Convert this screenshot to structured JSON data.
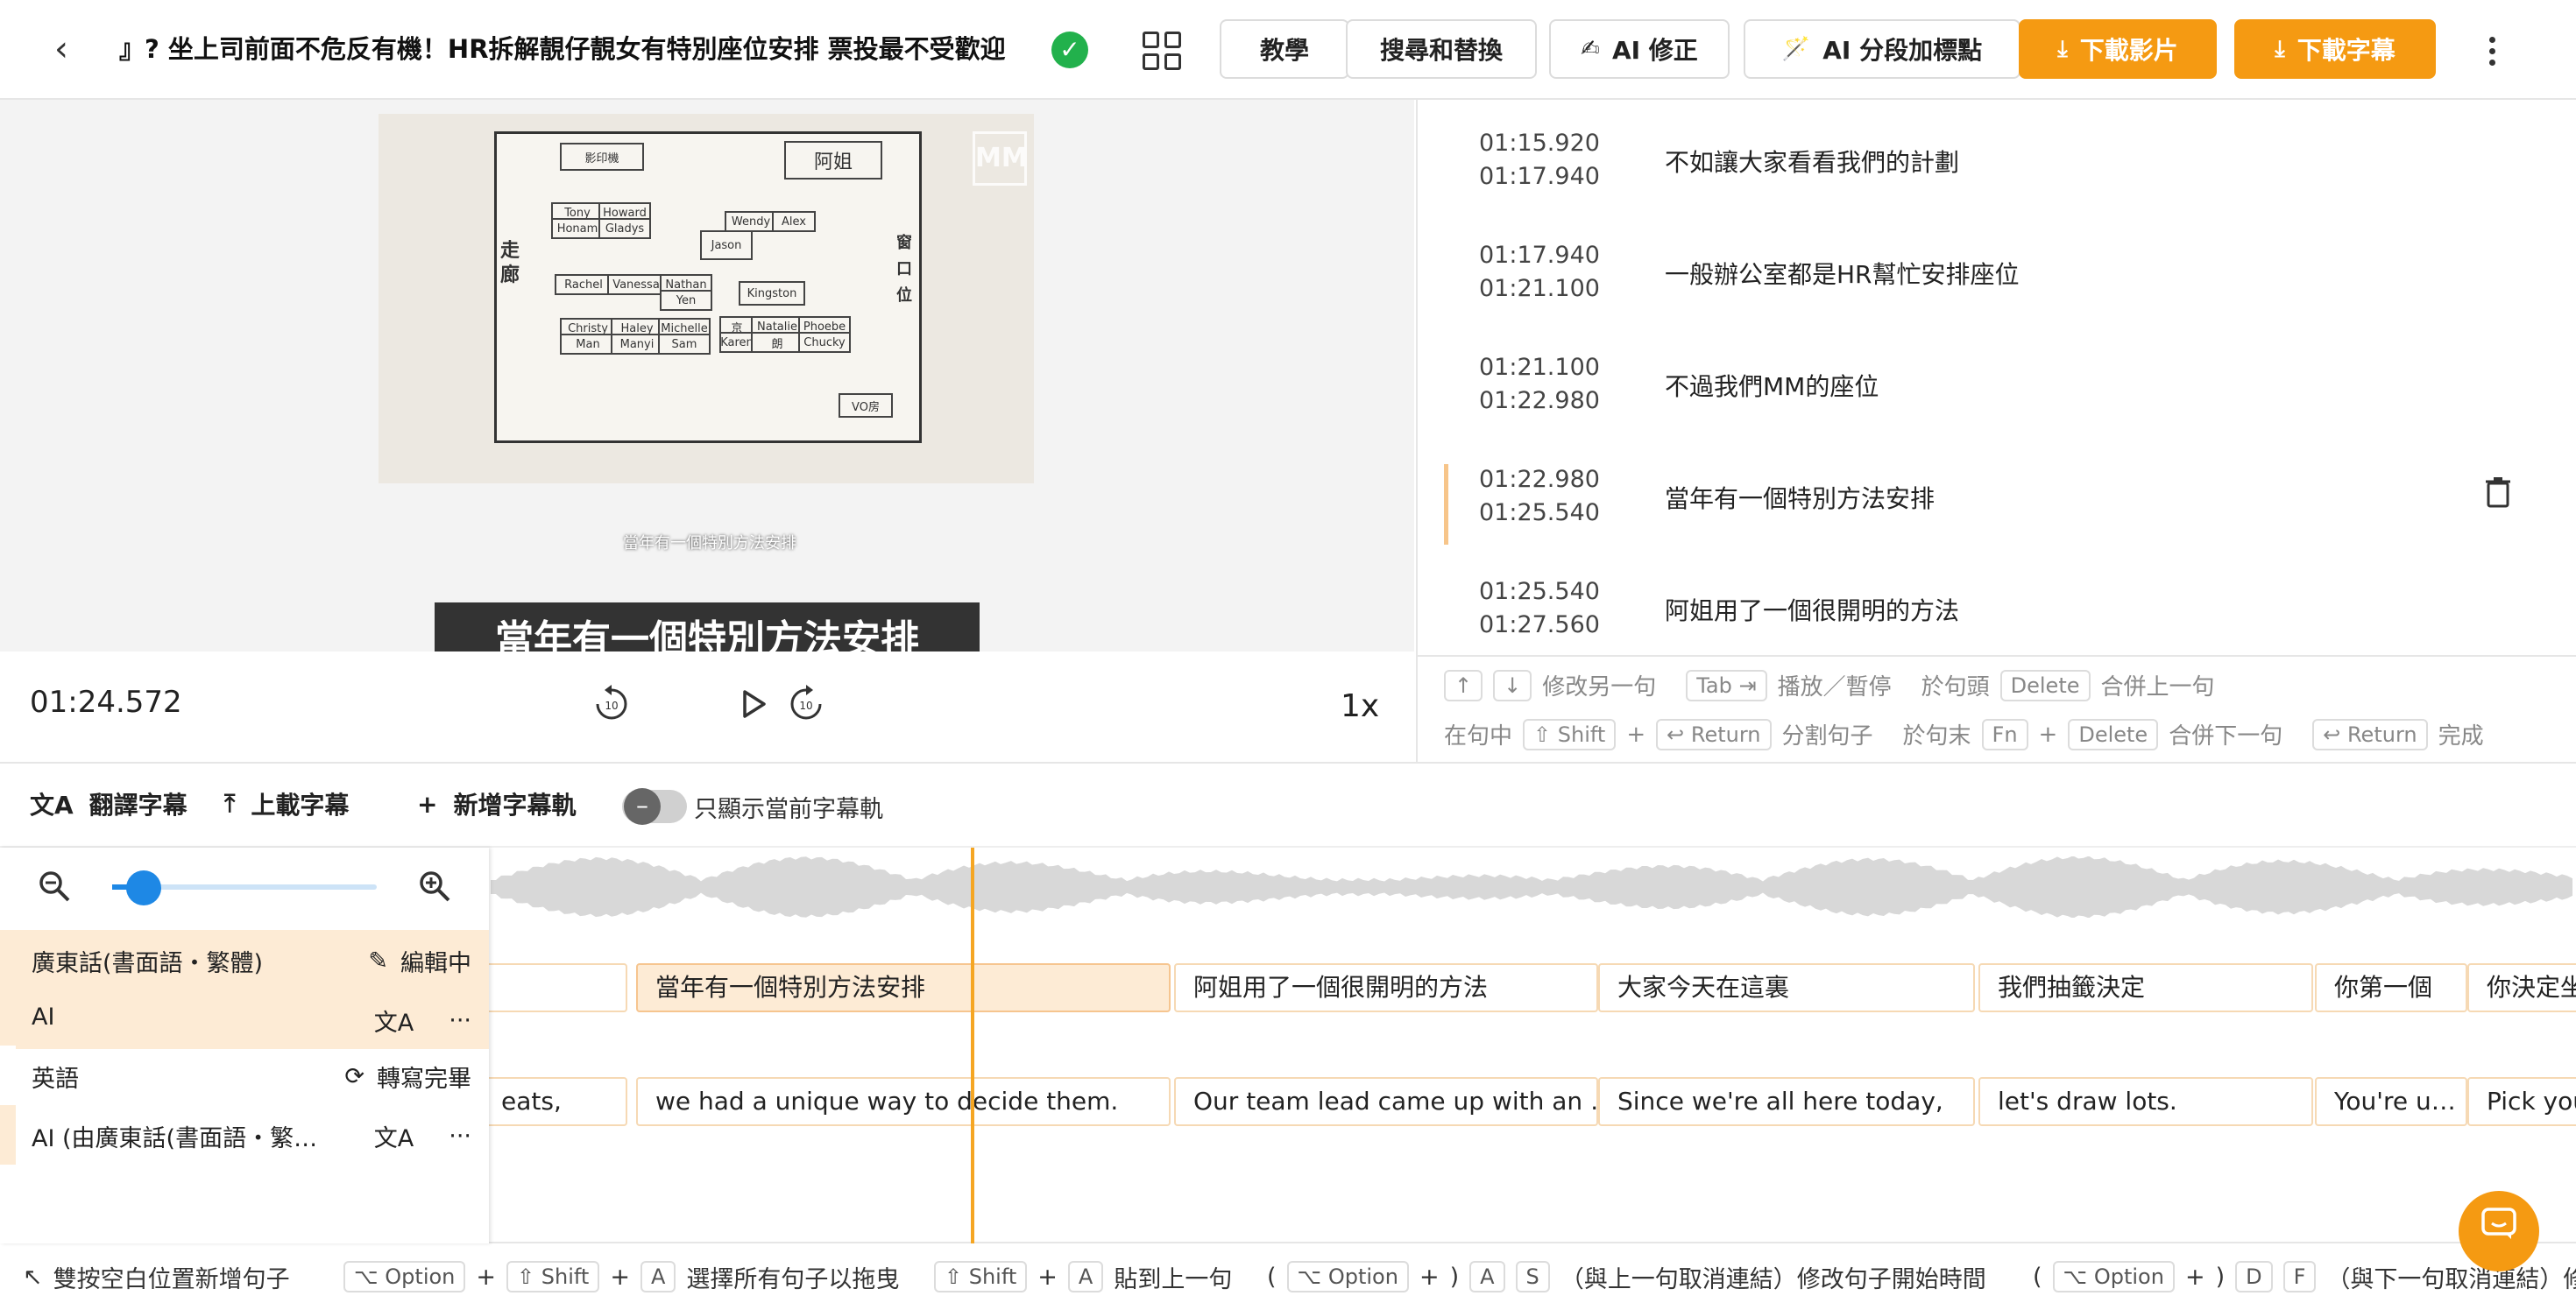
{
  "header": {
    "title": "』? 坐上司前面不危反有機！HR拆解靚仔靚女有特別座位安排 票投最不受歡迎",
    "buttons": {
      "tutorial": "教學",
      "find_replace": "搜尋和替換",
      "ai_correct": "AI 修正",
      "ai_segment": "AI 分段加標點",
      "download_video": "下載影片",
      "download_subtitles": "下載字幕"
    },
    "icons": {
      "ai_correct": "✍",
      "ai_segment": "🪄",
      "download": "⤓"
    }
  },
  "video": {
    "current_subtitle": "當年有一個特別方法安排",
    "burned_subtitle": "當年有一個特別方法安排",
    "watermark": "MM",
    "current_time": "01:24.572",
    "speed": "1x",
    "progress": 0.06,
    "drawing": {
      "printer": "影印機",
      "boss": "阿姐",
      "corridor": "走廊",
      "window": "窗口位",
      "names": [
        "Tony",
        "Howard",
        "Honam",
        "Gladys",
        "Wendy",
        "Alex",
        "Jason",
        "Rachel",
        "Vanessa",
        "Nathan",
        "Yen",
        "Kingston",
        "Christy",
        "Haley",
        "Michelle",
        "Man",
        "Manyi",
        "Sam",
        "京",
        "Natalie",
        "Phoebe",
        "Karen",
        "朗",
        "Chucky"
      ],
      "room": "VO房"
    }
  },
  "transcript": [
    {
      "start": "01:15.920",
      "end": "01:17.940",
      "text": "不如讓大家看看我們的計劃"
    },
    {
      "start": "01:17.940",
      "end": "01:21.100",
      "text": "一般辦公室都是HR幫忙安排座位"
    },
    {
      "start": "01:21.100",
      "end": "01:22.980",
      "text": "不過我們MM的座位"
    },
    {
      "start": "01:22.980",
      "end": "01:25.540",
      "text": "當年有一個特別方法安排",
      "active": true
    },
    {
      "start": "01:25.540",
      "end": "01:27.560",
      "text": "阿姐用了一個很開明的方法"
    }
  ],
  "hints": {
    "row1": {
      "up": "↑",
      "down": "↓",
      "modify_other": "修改另一句",
      "tab": "Tab ⇥",
      "play_pause": "播放／暫停",
      "at_start": "於句頭",
      "delete": "Delete",
      "merge_prev": "合併上一句"
    },
    "row2": {
      "in_sentence": "在句中",
      "shift": "⇧ Shift",
      "plus": "+",
      "return": "↩ Return",
      "split": "分割句子",
      "at_end": "於句末",
      "fn": "Fn",
      "delete": "Delete",
      "merge_next": "合併下一句",
      "return2": "↩ Return",
      "done": "完成"
    }
  },
  "toolbar": {
    "translate": "翻譯字幕",
    "upload": "上載字幕",
    "add_track": "新增字幕軌",
    "only_current": "只顯示當前字幕軌",
    "icons": {
      "translate": "文A",
      "upload": "⤒",
      "add": "+"
    }
  },
  "tracks": [
    {
      "name": "廣東話(書面語・繁體)",
      "status": "編輯中",
      "sub": "AI"
    },
    {
      "name": "英語",
      "status": "轉寫完畢",
      "sub": "AI (由廣東話(書面語・繁…"
    }
  ],
  "timeline": {
    "zoom": 0.12,
    "lane1": [
      "",
      "當年有一個特別方法安排",
      "阿姐用了一個很開明的方法",
      "大家今天在這裏",
      "我們抽籤決定",
      "你第一個",
      "你決定坐"
    ],
    "lane2": [
      "eats,",
      "we had a unique way to decide them.",
      "Our team lead came up with an …",
      "Since we're all here today,",
      "let's draw lots.",
      "You're u…",
      "Pick you"
    ]
  },
  "bottom_hints": {
    "add_sentence": "雙按空白位置新增句子",
    "option": "⌥ Option",
    "shift": "⇧ Shift",
    "a": "A",
    "plus": "+",
    "select_all": "選擇所有句子以拖曳",
    "paste_prev": "貼到上一句",
    "paren_open": "(",
    "paren_close": ")",
    "s": "S",
    "d": "D",
    "f": "F",
    "modify_start": "（與上一句取消連結）修改句子開始時間",
    "modify_end": "（與下一句取消連結）修"
  }
}
